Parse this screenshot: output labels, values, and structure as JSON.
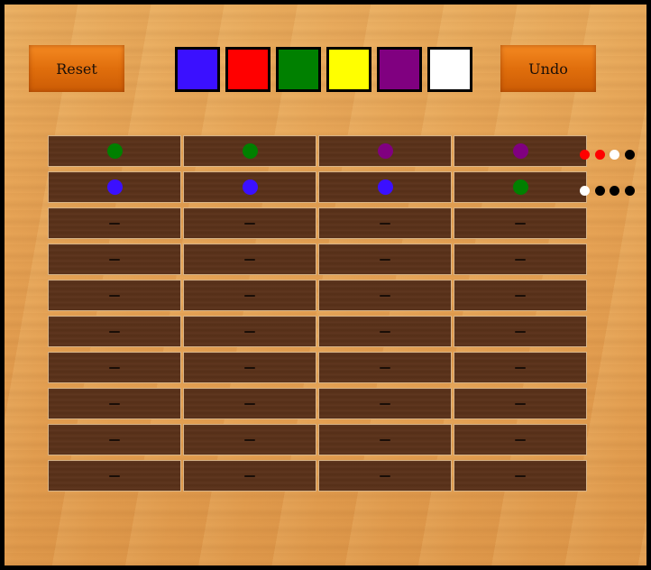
{
  "controls": {
    "reset_label": "Reset",
    "undo_label": "Undo"
  },
  "palette": [
    {
      "name": "blue",
      "color": "#3b10ff"
    },
    {
      "name": "red",
      "color": "#ff0000"
    },
    {
      "name": "green",
      "color": "#008000"
    },
    {
      "name": "yellow",
      "color": "#ffff00"
    },
    {
      "name": "purple",
      "color": "#800080"
    },
    {
      "name": "white",
      "color": "#ffffff"
    }
  ],
  "rows": [
    {
      "pegs": [
        "#008000",
        "#008000",
        "#800080",
        "#800080"
      ],
      "feedback": [
        "red",
        "red",
        "white",
        "black"
      ]
    },
    {
      "pegs": [
        "#3b10ff",
        "#3b10ff",
        "#3b10ff",
        "#008000"
      ],
      "feedback": [
        "white",
        "black",
        "black",
        "black"
      ]
    },
    {
      "pegs": [
        null,
        null,
        null,
        null
      ],
      "feedback": []
    },
    {
      "pegs": [
        null,
        null,
        null,
        null
      ],
      "feedback": []
    },
    {
      "pegs": [
        null,
        null,
        null,
        null
      ],
      "feedback": []
    },
    {
      "pegs": [
        null,
        null,
        null,
        null
      ],
      "feedback": []
    },
    {
      "pegs": [
        null,
        null,
        null,
        null
      ],
      "feedback": []
    },
    {
      "pegs": [
        null,
        null,
        null,
        null
      ],
      "feedback": []
    },
    {
      "pegs": [
        null,
        null,
        null,
        null
      ],
      "feedback": []
    },
    {
      "pegs": [
        null,
        null,
        null,
        null
      ],
      "feedback": []
    }
  ],
  "feedback_colors": {
    "red": "#ff0000",
    "white": "#ffffff",
    "black": "#000000"
  }
}
